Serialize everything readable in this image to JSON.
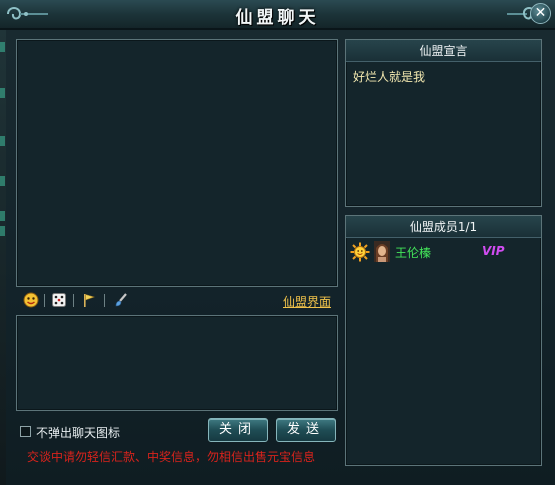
{
  "window": {
    "title": "仙盟聊天",
    "close_glyph": "✕"
  },
  "chat": {
    "toolbar_icons": [
      "smiley-icon",
      "dice-icon",
      "flag-icon",
      "brush-icon"
    ],
    "guild_ui_link": "仙盟界面",
    "input_value": "",
    "no_popup_label": "不弹出聊天图标",
    "no_popup_checked": false,
    "close_label": "关闭",
    "send_label": "发送",
    "warning": "交谈中请勿轻信汇款、中奖信息，勿相信出售元宝信息"
  },
  "declaration": {
    "header": "仙盟宣言",
    "text": "好烂人就是我"
  },
  "members": {
    "header": "仙盟成员1/1",
    "list": [
      {
        "status_icon": "sun-icon",
        "name": "王伦榛",
        "badge": "VIP"
      }
    ]
  },
  "colors": {
    "accent_gold": "#f0c24a",
    "member_name": "#43e65a",
    "vip": "#d04cf0",
    "warning": "#d8231c"
  }
}
